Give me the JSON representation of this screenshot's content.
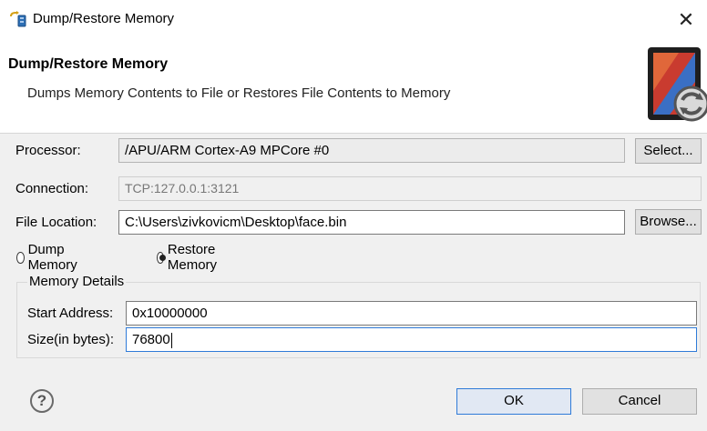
{
  "window": {
    "title": "Dump/Restore Memory",
    "close_glyph": "✕"
  },
  "header": {
    "title": "Dump/Restore Memory",
    "description": "Dumps Memory Contents to File or Restores File Contents to Memory"
  },
  "form": {
    "processor": {
      "label": "Processor:",
      "value": "/APU/ARM Cortex-A9 MPCore #0",
      "button": "Select..."
    },
    "connection": {
      "label": "Connection:",
      "value": "TCP:127.0.0.1:3121"
    },
    "file_location": {
      "label": "File Location:",
      "value": "C:\\Users\\zivkovicm\\Desktop\\face.bin",
      "button": "Browse..."
    },
    "mode": {
      "options": [
        {
          "label": "Dump Memory",
          "selected": false
        },
        {
          "label": "Restore Memory",
          "selected": true
        }
      ]
    },
    "memory_details": {
      "title": "Memory Details",
      "start_address": {
        "label": "Start Address:",
        "value": "0x10000000"
      },
      "size": {
        "label": "Size(in bytes):",
        "value": "76800"
      }
    }
  },
  "footer": {
    "help_glyph": "?",
    "ok_label": "OK",
    "cancel_label": "Cancel"
  },
  "icons": {
    "title_icon": "memory-restore-icon",
    "header_graphic": "memory-chip-refresh-icon",
    "help": "help-icon"
  },
  "colors": {
    "accent": "#2f7bd8",
    "dialog_bg": "#f0f0f0",
    "header_bg": "#ffffff"
  }
}
